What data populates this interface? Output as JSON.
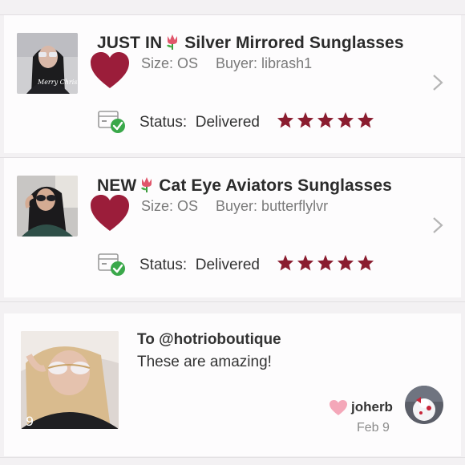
{
  "listings": [
    {
      "badge": "JUST IN",
      "title": "Silver Mirrored Sunglasses",
      "size_label": "Size: OS",
      "buyer_label": "Buyer: librash1",
      "status_label": "Status:",
      "status_value": "Delivered",
      "rating": 5,
      "thumb_caption": "Merry Christmas"
    },
    {
      "badge": "NEW",
      "title": "Cat Eye Aviators Sunglasses",
      "size_label": "Size: OS",
      "buyer_label": "Buyer: butterflylvr",
      "status_label": "Status:",
      "status_value": "Delivered",
      "rating": 5
    }
  ],
  "comment": {
    "to": "To @hotrioboutique",
    "body": "These are amazing!",
    "username": "joherb",
    "date": "Feb 9"
  },
  "colors": {
    "heart": "#9b1d3a",
    "star": "#8a1c2f",
    "check": "#3aa84a",
    "like_heart": "#f4a7b9"
  },
  "icons": [
    "tulip-icon",
    "heart-icon",
    "chevron-right-icon",
    "delivery-box-icon",
    "check-icon",
    "star-icon"
  ]
}
